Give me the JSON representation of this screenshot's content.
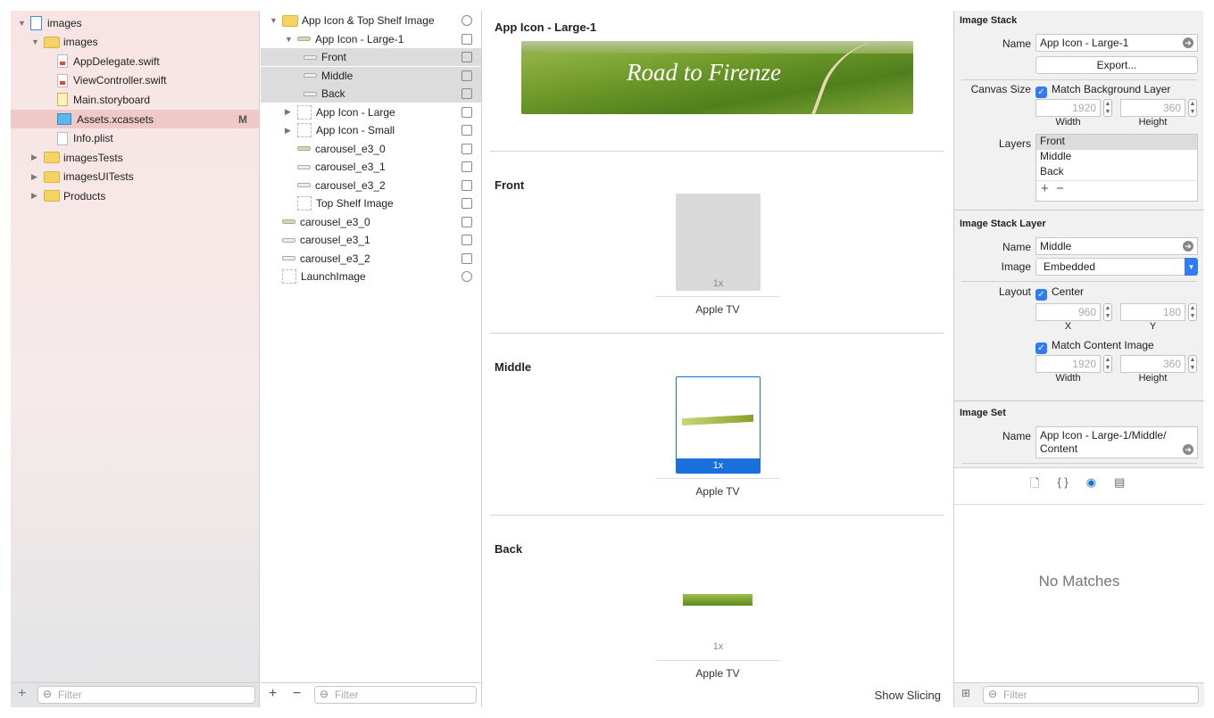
{
  "navigator": {
    "items": [
      {
        "label": "images",
        "type": "project",
        "level": 0,
        "open": true
      },
      {
        "label": "images",
        "type": "folder",
        "level": 1,
        "open": true
      },
      {
        "label": "AppDelegate.swift",
        "type": "swift",
        "level": 2
      },
      {
        "label": "ViewController.swift",
        "type": "swift",
        "level": 2
      },
      {
        "label": "Main.storyboard",
        "type": "storyboard",
        "level": 2
      },
      {
        "label": "Assets.xcassets",
        "type": "xcassets",
        "level": 2,
        "badge": "M",
        "selected": true
      },
      {
        "label": "Info.plist",
        "type": "plist",
        "level": 2
      },
      {
        "label": "imagesTests",
        "type": "folder",
        "level": 1,
        "open": false
      },
      {
        "label": "imagesUITests",
        "type": "folder",
        "level": 1,
        "open": false
      },
      {
        "label": "Products",
        "type": "folder",
        "level": 1,
        "open": false
      }
    ],
    "filter_placeholder": "Filter"
  },
  "assets": {
    "items": [
      {
        "label": "App Icon & Top Shelf Image",
        "level": 0
      },
      {
        "label": "App Icon - Large-1",
        "level": 1
      },
      {
        "label": "Front",
        "level": 2
      },
      {
        "label": "Middle",
        "level": 2
      },
      {
        "label": "Back",
        "level": 2
      },
      {
        "label": "App Icon - Large",
        "level": 1
      },
      {
        "label": "App Icon - Small",
        "level": 1
      },
      {
        "label": "carousel_e3_0",
        "level": 1
      },
      {
        "label": "carousel_e3_1",
        "level": 1
      },
      {
        "label": "carousel_e3_2",
        "level": 1
      },
      {
        "label": "Top Shelf Image",
        "level": 1
      },
      {
        "label": "carousel_e3_0",
        "level": 0
      },
      {
        "label": "carousel_e3_1",
        "level": 0
      },
      {
        "label": "carousel_e3_2",
        "level": 0
      },
      {
        "label": "LaunchImage",
        "level": 0
      }
    ],
    "filter_placeholder": "Filter",
    "add": "+",
    "remove": "−"
  },
  "editor": {
    "title": "App Icon - Large-1",
    "banner_text": "Road to Firenze",
    "layers": [
      {
        "name": "Front",
        "scale": "1x",
        "device": "Apple TV"
      },
      {
        "name": "Middle",
        "scale": "1x",
        "device": "Apple TV"
      },
      {
        "name": "Back",
        "scale": "1x",
        "device": "Apple TV"
      }
    ],
    "show_slicing": "Show Slicing",
    "accent": "#1a6fdc"
  },
  "inspector": {
    "image_stack": {
      "title": "Image Stack",
      "name_label": "Name",
      "name": "App Icon - Large-1",
      "export": "Export...",
      "canvas_label": "Canvas Size",
      "match_bg": "Match Background Layer",
      "width": "1920",
      "height": "360",
      "width_label": "Width",
      "height_label": "Height",
      "layers_label": "Layers",
      "layers": [
        "Front",
        "Middle",
        "Back"
      ],
      "add": "+",
      "remove": "−"
    },
    "stack_layer": {
      "title": "Image Stack Layer",
      "name_label": "Name",
      "name": "Middle",
      "image_label": "Image",
      "image": "Embedded",
      "layout_label": "Layout",
      "center": "Center",
      "x": "960",
      "y": "180",
      "x_label": "X",
      "y_label": "Y",
      "match_content": "Match Content Image",
      "width": "1920",
      "height": "360",
      "width_label": "Width",
      "height_label": "Height"
    },
    "image_set": {
      "title": "Image Set",
      "name_label": "Name",
      "name_line1": "App Icon - Large-1/Middle/",
      "name_line2": "Content"
    },
    "no_matches": "No Matches",
    "filter_placeholder": "Filter"
  }
}
